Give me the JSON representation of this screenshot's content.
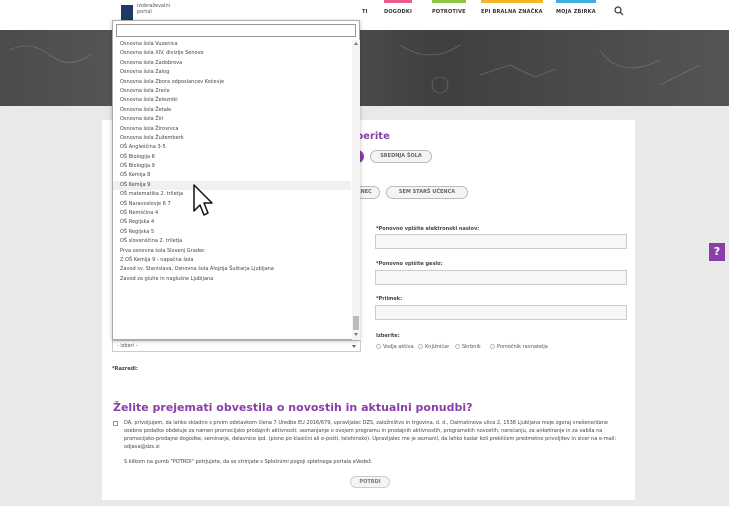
{
  "header": {
    "logo_text": [
      "izobraževalni",
      "portal"
    ],
    "nav": [
      {
        "label": "DOGODKI",
        "color": "#e85b8b"
      },
      {
        "label": "POTROTIVE",
        "color": "#8dc63f"
      },
      {
        "label": "EPI BRALNA ZNAČKA",
        "color": "#f3b629"
      },
      {
        "label": "MOJA ZBIRKA",
        "color": "#3fb0e0"
      }
    ],
    "partial_nav": "TI",
    "search_icon": "search-icon"
  },
  "form": {
    "heading_fragment": "berite",
    "school_pill_1": "",
    "school_pill_2": "SREDNJA ŠOLA",
    "role_pill_1": "ENEC",
    "role_pill_2": "SEM STARŠ UČENCA",
    "label_email_repeat": "*Ponovno vpišite elektronski naslov:",
    "label_password_repeat": "*Ponovno vpišite geslo:",
    "label_surname": "*Priimek:",
    "label_choose": "Izberite:",
    "radios": [
      "Vodja aktiva",
      "Knjižničar",
      "Skrbnik",
      "Pomočnik ravnatelja"
    ],
    "select_value": "- izberi -",
    "label_class": "*Razredi:"
  },
  "dropdown": {
    "search_value": "",
    "highlighted_index": 15,
    "items": [
      "Osnovna šola Vuzenica",
      "Osnovna šola XIV. divizije Senovo",
      "Osnovna šola Zadobrova",
      "Osnovna šola Zalog",
      "Osnovna šola Zbora odposlancev Kočevje",
      "Osnovna šola Zreče",
      "Osnovna šola Železniki",
      "Osnovna šola Žetale",
      "Osnovna šola Žiri",
      "Osnovna šola Žirovnica",
      "Osnovna šola Žužemberk",
      "OŠ Angleščina 3-5",
      "OŠ Biologija 8",
      "OŠ Biologija 9",
      "OŠ Kemija 8",
      "OŠ Kemija 9",
      "OŠ matematika 2. triletja",
      "OŠ Naravoslovje 6 7",
      "OŠ Nemščina 4",
      "OŠ Regijska 4",
      "OŠ Regijska 5",
      "OŠ slovenščina 2. triletja",
      "Prva osnovna šola Slovenj Gradec",
      "Z OŠ Kemija 9 - napačna šola",
      "Zavod sv. Stanislava, Osnovna šola Alojzija Šuštarja Ljubljana",
      "Zavod za gluhe in naglušne Ljubljana"
    ]
  },
  "newsletter": {
    "title": "Želite prejemati obvestila o novostih in aktualni ponudbi?",
    "consent": "DA, privoljujem, da lahko skladno s prvim odstavkom člena 7 Uredbe EU 2016/679, upravljalec DZS, založništvo in trgovina, d. d., Dalmatinova ulica 2, 1538 Ljubljana moje zgoraj vnešene/dane osebne podatke obdeluje za namen promocijsko prodajnih aktivnosti: seznanjanje o ovojem programu in prodajnih aktivnostih, programskih novostih, naročanju, za anketiranje in za vabila na promocijsko-prodajne dogodke, seminarje, delavnice ipd. (pisno po klasični ali e-pošti, telefonsko). Upravljalec me je seznanil, da lahko kadar koli prekličem predmetno privoljitev in sicer na e-mail: odjava@dzs.si",
    "terms": "S klikom na gumb \"POTRDI\" potrjujete, da se strinjate s Splošnimi pogoji spletnega portala eVedež.",
    "confirm_label": "POTRDI"
  },
  "help": {
    "label": "?"
  },
  "colors": {
    "accent": "#8a3fa6",
    "logo": "#1d3a63"
  }
}
